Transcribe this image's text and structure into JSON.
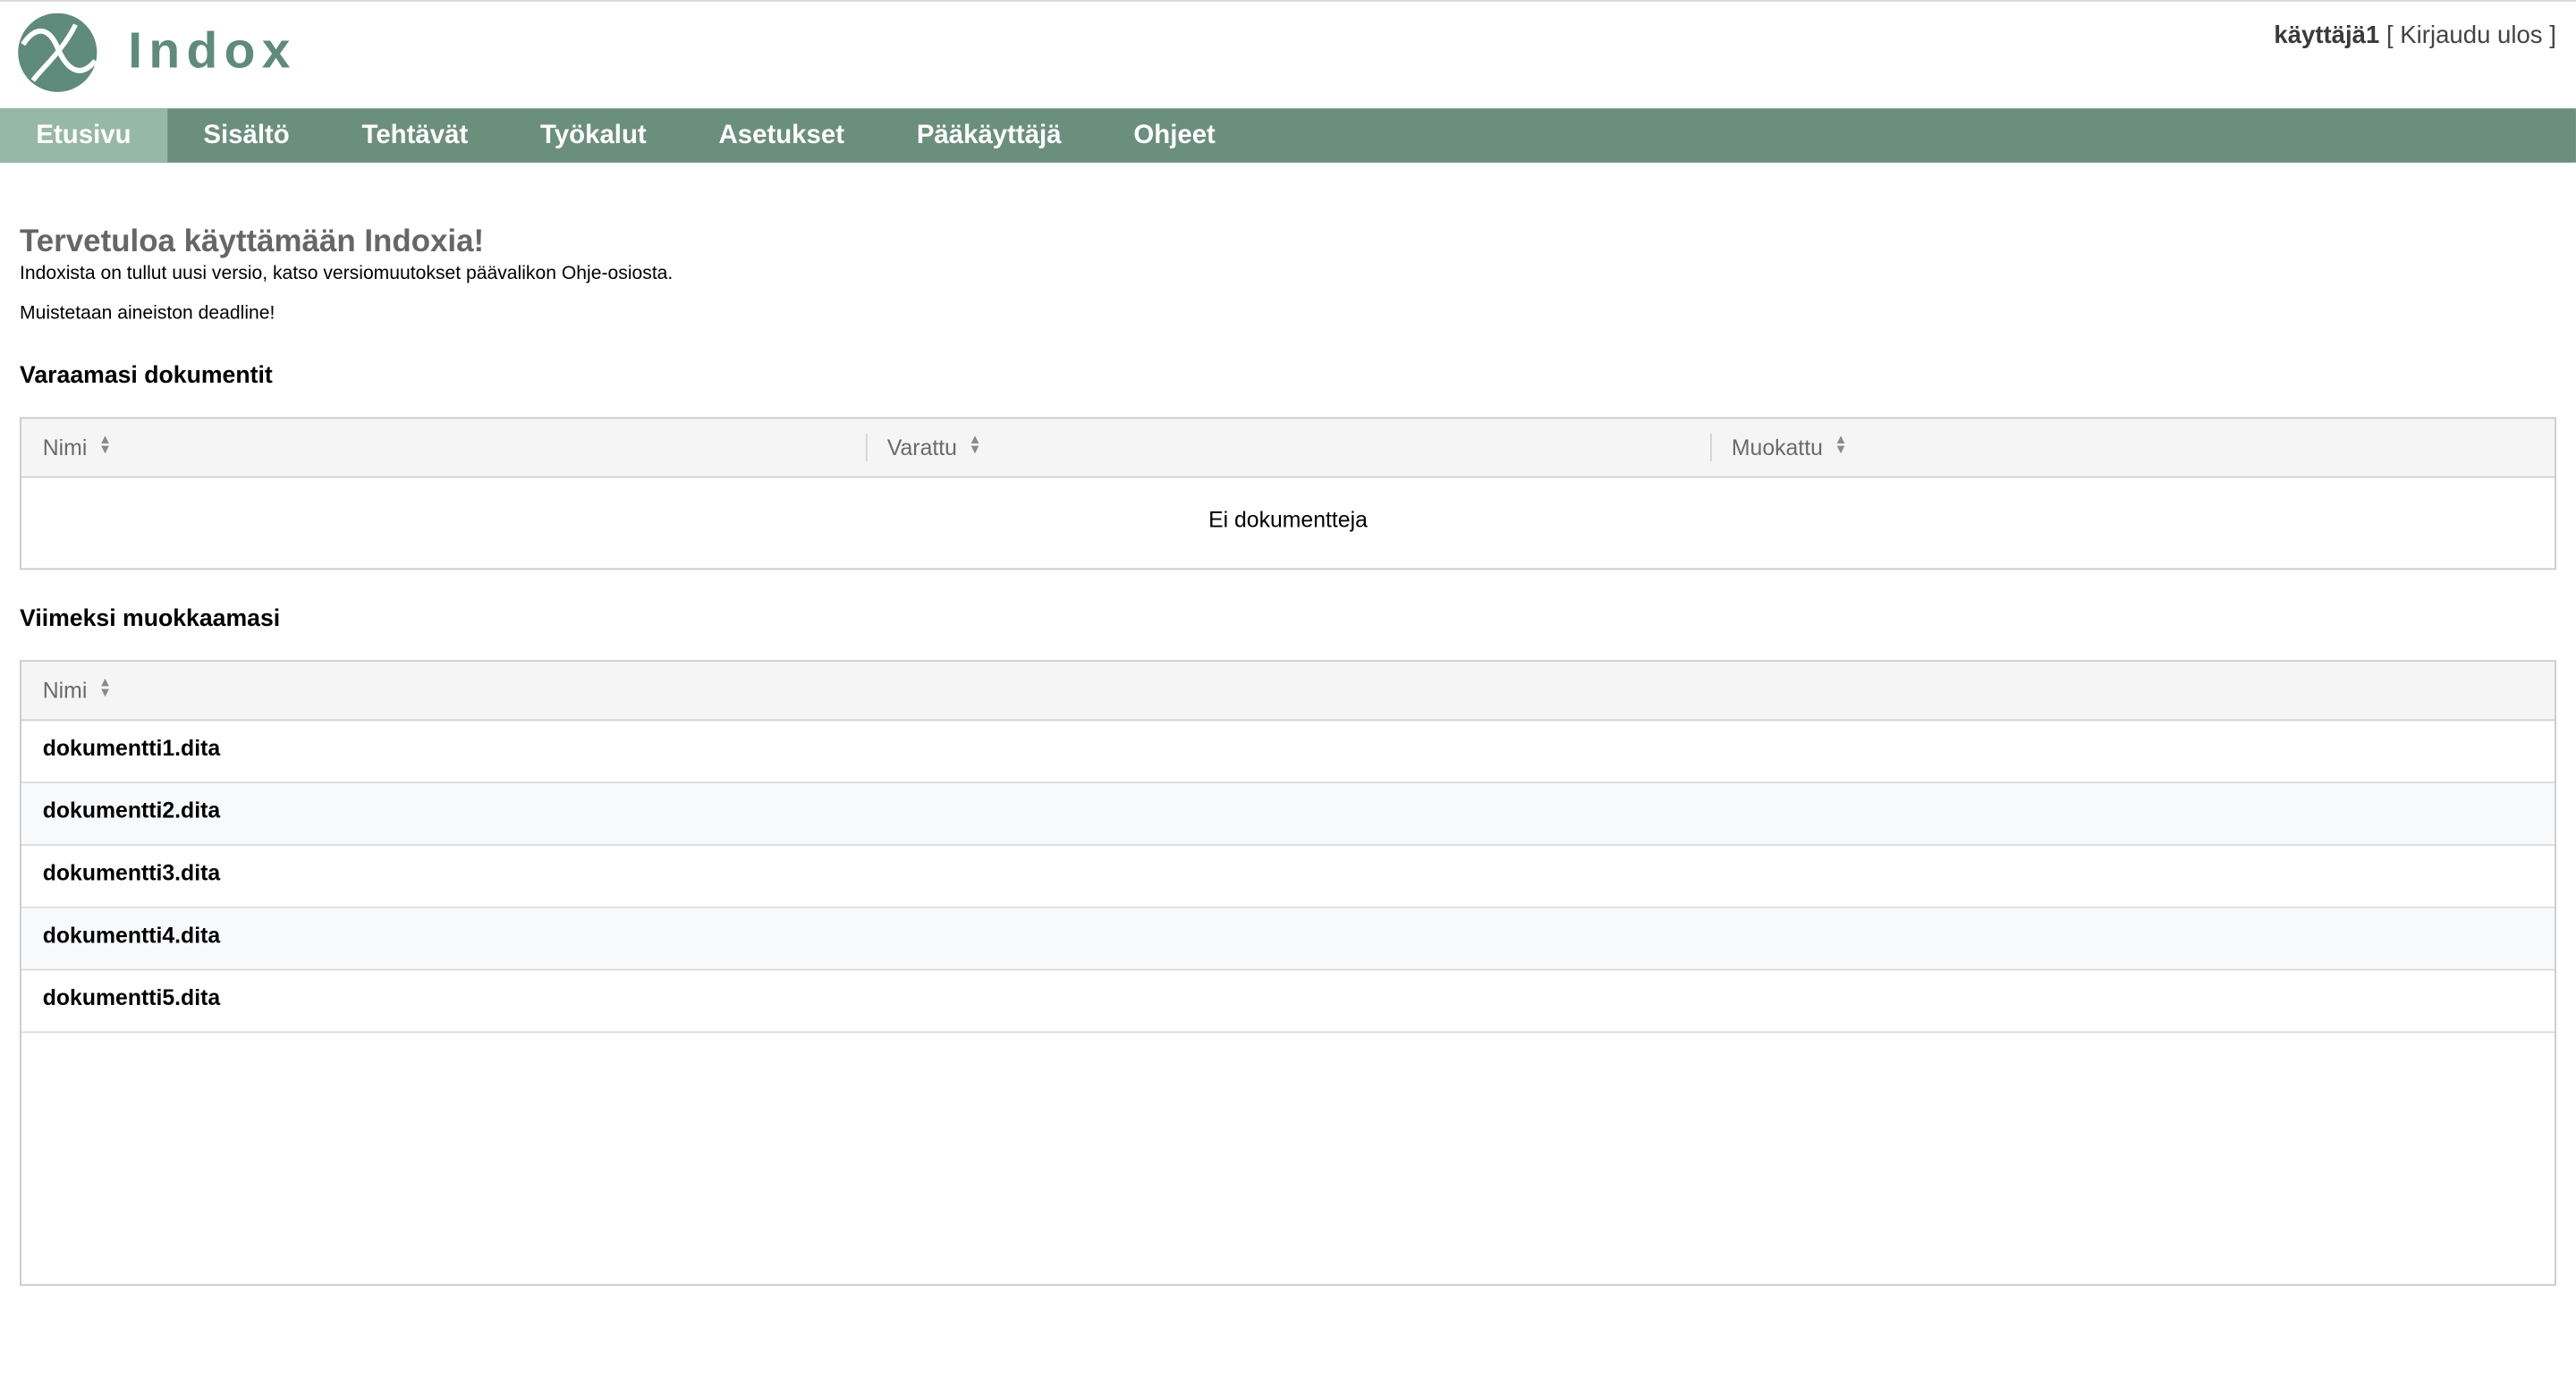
{
  "app": {
    "logo_text": "Indox",
    "user_name": "käyttäjä1",
    "bracket_open": "[",
    "logout_label": "Kirjaudu ulos",
    "bracket_close": "]",
    "accent_color": "#6b8f7d",
    "active_tab_color": "#96b8a6",
    "logo_color": "#5e8b7b"
  },
  "nav": {
    "items": [
      {
        "label": "Etusivu",
        "active": true
      },
      {
        "label": "Sisältö"
      },
      {
        "label": "Tehtävät"
      },
      {
        "label": "Työkalut"
      },
      {
        "label": "Asetukset"
      },
      {
        "label": "Pääkäyttäjä"
      },
      {
        "label": "Ohjeet"
      }
    ]
  },
  "welcome": {
    "title": "Tervetuloa käyttämään Indoxia!",
    "text": "Indoxista on tullut uusi versio, katso versiomuutokset päävalikon Ohje-osiosta.",
    "notice": "Muistetaan aineiston deadline!"
  },
  "reserved": {
    "title": "Varaamasi dokumentit",
    "columns": [
      "Nimi",
      "Varattu",
      "Muokattu"
    ],
    "empty_text": "Ei dokumentteja"
  },
  "recent": {
    "title": "Viimeksi muokkaamasi",
    "columns": [
      "Nimi"
    ],
    "rows": [
      "dokumentti1.dita",
      "dokumentti2.dita",
      "dokumentti3.dita",
      "dokumentti4.dita",
      "dokumentti5.dita"
    ]
  },
  "icons": {
    "logo": "indox-logo-icon",
    "sort": "sort-arrows-icon"
  }
}
